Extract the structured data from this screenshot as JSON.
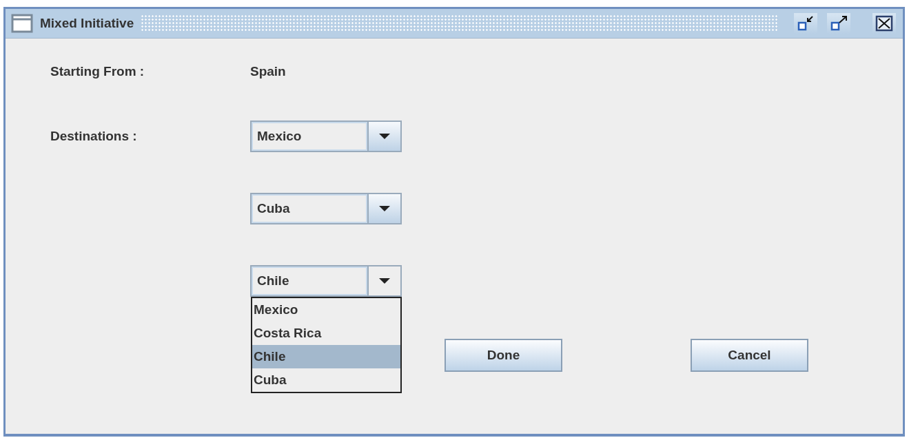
{
  "window": {
    "title": "Mixed Initiative"
  },
  "starting_from": {
    "label": "Starting From :",
    "value": "Spain"
  },
  "destinations": {
    "label": "Destinations :",
    "combos": [
      {
        "value": "Mexico",
        "expanded": false
      },
      {
        "value": "Cuba",
        "expanded": false
      },
      {
        "value": "Chile",
        "expanded": true,
        "options": [
          {
            "label": "Mexico",
            "selected": false
          },
          {
            "label": "Costa Rica",
            "selected": false
          },
          {
            "label": "Chile",
            "selected": true
          },
          {
            "label": "Cuba",
            "selected": false
          }
        ]
      }
    ]
  },
  "buttons": [
    "Done",
    "Cancel"
  ]
}
